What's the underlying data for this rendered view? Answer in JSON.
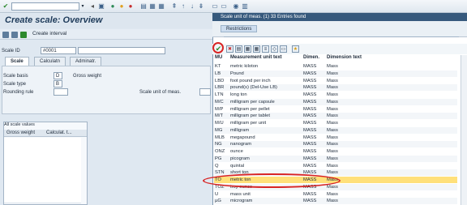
{
  "toolbar": {
    "dropdown_arrow": "▾"
  },
  "title": "Create scale: Overview",
  "app_toolbar": {
    "create_interval": "Create interval"
  },
  "form": {
    "scale_id_label": "Scale ID",
    "scale_id_value": "#0001",
    "tabs": [
      "Scale",
      "Calculatn",
      "Adminatr."
    ],
    "scale_basis_label": "Scale basis",
    "scale_basis_value": "D",
    "gross_weight_label": "Gross weight",
    "scale_type_label": "Scale type",
    "scale_type_value": "B",
    "rounding_rule_label": "Rounding rule",
    "scale_uom_label": "Scale unit of meas."
  },
  "grid": {
    "title": "All scale values",
    "col1": "Gross weight",
    "col2": "Calculat. t..."
  },
  "popup": {
    "title": "Scale unit of meas. (1)  33 Entries found",
    "restrictions_tab": "Restrictions",
    "headers": {
      "mu": "MU",
      "text": "Measurement unit text",
      "dimen": "Dimen.",
      "dimtext": "Dimension text"
    },
    "rows": [
      {
        "mu": "KT",
        "text": "metric kiloton",
        "dimen": "MASS",
        "dimtext": "Mass"
      },
      {
        "mu": "LB",
        "text": "Pound",
        "dimen": "MASS",
        "dimtext": "Mass"
      },
      {
        "mu": "LBD",
        "text": "foot pound per inch",
        "dimen": "MASS",
        "dimtext": "Mass"
      },
      {
        "mu": "LBR",
        "text": "pound(s)     (Del-Use LB)",
        "dimen": "MASS",
        "dimtext": "Mass"
      },
      {
        "mu": "LTN",
        "text": "long ton",
        "dimen": "MASS",
        "dimtext": "Mass"
      },
      {
        "mu": "M/C",
        "text": "milligram per capsule",
        "dimen": "MASS",
        "dimtext": "Mass"
      },
      {
        "mu": "M/P",
        "text": "milligram per pellet",
        "dimen": "MASS",
        "dimtext": "Mass"
      },
      {
        "mu": "M/T",
        "text": "milligram per tablet",
        "dimen": "MASS",
        "dimtext": "Mass"
      },
      {
        "mu": "M/U",
        "text": "milligram per unit",
        "dimen": "MASS",
        "dimtext": "Mass"
      },
      {
        "mu": "MG",
        "text": "milligram",
        "dimen": "MASS",
        "dimtext": "Mass"
      },
      {
        "mu": "MLB",
        "text": "megapound",
        "dimen": "MASS",
        "dimtext": "Mass"
      },
      {
        "mu": "NG",
        "text": "nanogram",
        "dimen": "MASS",
        "dimtext": "Mass"
      },
      {
        "mu": "ONZ",
        "text": "ounce",
        "dimen": "MASS",
        "dimtext": "Mass"
      },
      {
        "mu": "PG",
        "text": "picogram",
        "dimen": "MASS",
        "dimtext": "Mass"
      },
      {
        "mu": "Q",
        "text": "quintal",
        "dimen": "MASS",
        "dimtext": "Mass"
      },
      {
        "mu": "STN",
        "text": "short ton",
        "dimen": "MASS",
        "dimtext": "Mass"
      },
      {
        "mu": "TO",
        "text": "metric ton",
        "dimen": "MASS",
        "dimtext": "Mass"
      },
      {
        "mu": "TOZ",
        "text": "troy ounce",
        "dimen": "MASS",
        "dimtext": "Mass"
      },
      {
        "mu": "U",
        "text": "mass unit",
        "dimen": "MASS",
        "dimtext": "Mass"
      },
      {
        "mu": "µG",
        "text": "microgram",
        "dimen": "MASS",
        "dimtext": "Mass"
      }
    ]
  },
  "colors": {
    "accent": "#36597d",
    "highlight": "#ffe07a",
    "annotation": "#d82424"
  }
}
